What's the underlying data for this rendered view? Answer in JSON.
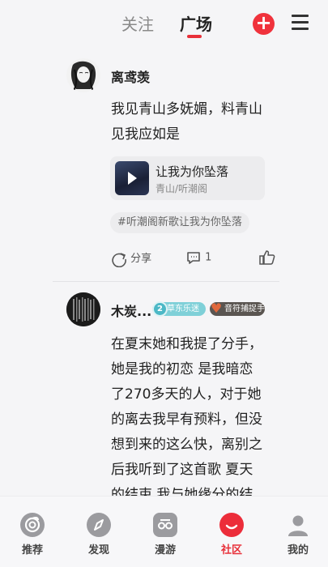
{
  "header": {
    "tabs": [
      "关注",
      "广场"
    ],
    "active_tab": "广场",
    "add_label": "+"
  },
  "posts": [
    {
      "username": "离鸢羡",
      "text_lines": [
        "我见青山多妩媚，料青山",
        "见我应如是"
      ],
      "music": {
        "title": "让我为你坠落",
        "artist": "青山/听潮阁"
      },
      "tag": "#听潮阁新歌让我为你坠落",
      "share_label": "分享",
      "comment_count": "1"
    },
    {
      "username": "木炭...",
      "badges": [
        {
          "level": "2",
          "label": "草东乐迷"
        },
        {
          "label": "音符捕捉手"
        }
      ],
      "text_lines": [
        "在夏末她和我提了分手，",
        "她是我的初恋 是我暗恋",
        "了270多天的人，对于她",
        "的离去我早有预料，但没",
        "想到来的这么快，离别之",
        "后我听到了这首歌 夏天",
        "的结束 我与她缘分的结"
      ]
    }
  ],
  "tabbar": {
    "items": [
      {
        "label": "推荐",
        "icon": "recommend-icon"
      },
      {
        "label": "发现",
        "icon": "compass-icon"
      },
      {
        "label": "漫游",
        "icon": "roam-icon"
      },
      {
        "label": "社区",
        "icon": "community-icon"
      },
      {
        "label": "我的",
        "icon": "profile-icon"
      }
    ],
    "active": "社区"
  },
  "colors": {
    "accent": "#e8303a",
    "background": "#f5f5f7"
  }
}
